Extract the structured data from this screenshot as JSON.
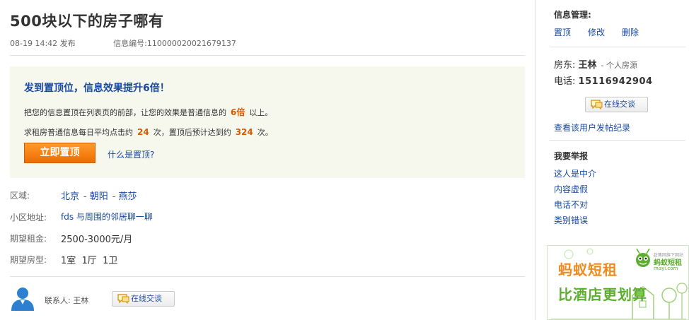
{
  "post": {
    "title": "500块以下的房子哪有",
    "posted": "08-19 14:42 发布",
    "info_id": "信息编号:110000020021679137"
  },
  "promo": {
    "headline": "发到置顶位，信息效果提升6倍！",
    "line1_pre": "把您的信息置顶在列表页的前部，让您的效果是普通信息的",
    "line1_num": "6倍",
    "line1_post": "以上。",
    "line2_pre": "求租房普通信息每日平均点击约",
    "line2_num1": "24",
    "line2_mid": "次，置顶后预计达到约",
    "line2_num2": "324",
    "line2_post": "次。",
    "button": "立即置顶",
    "help_link": "什么是置顶?"
  },
  "details": {
    "area_label": "区域:",
    "area_city": "北京",
    "area_district": "朝阳",
    "area_sub": "燕莎",
    "community_label": "小区地址:",
    "community_value": "fds 与周围的邻居聊一聊",
    "rent_label": "期望租金:",
    "rent_value": "2500-3000元/月",
    "type_label": "期望房型:",
    "type_value": "1室  1厅  1卫"
  },
  "contact": {
    "label": "联系人: 王林",
    "chat_button": "在线交谈"
  },
  "sidebar": {
    "manage_title": "信息管理:",
    "manage_links": [
      "置顶",
      "修改",
      "删除"
    ],
    "landlord_label": "房东:",
    "landlord_name": "王林",
    "landlord_tag": "- 个人房源",
    "phone_label": "电话:",
    "phone_value": "15116942904",
    "chat_button": "在线交谈",
    "history_link": "查看该用户发帖纪录",
    "report_title": "我要举报",
    "report_links": [
      "这人是中介",
      "内容虚假",
      "电话不对",
      "类别错误"
    ]
  },
  "ad": {
    "brand": "蚂蚁短租",
    "slogan": "比酒店更划算",
    "logo_small": "蚂蚁短租",
    "logo_tag": "赶集网旗下网站",
    "logo_url": "mayi.com"
  },
  "colors": {
    "link": "#1a4aa0",
    "accent_orange": "#ef6b00",
    "highlight": "#d85a00",
    "promo_bg": "#f6f8ee",
    "ad_green": "#5cae2e"
  }
}
